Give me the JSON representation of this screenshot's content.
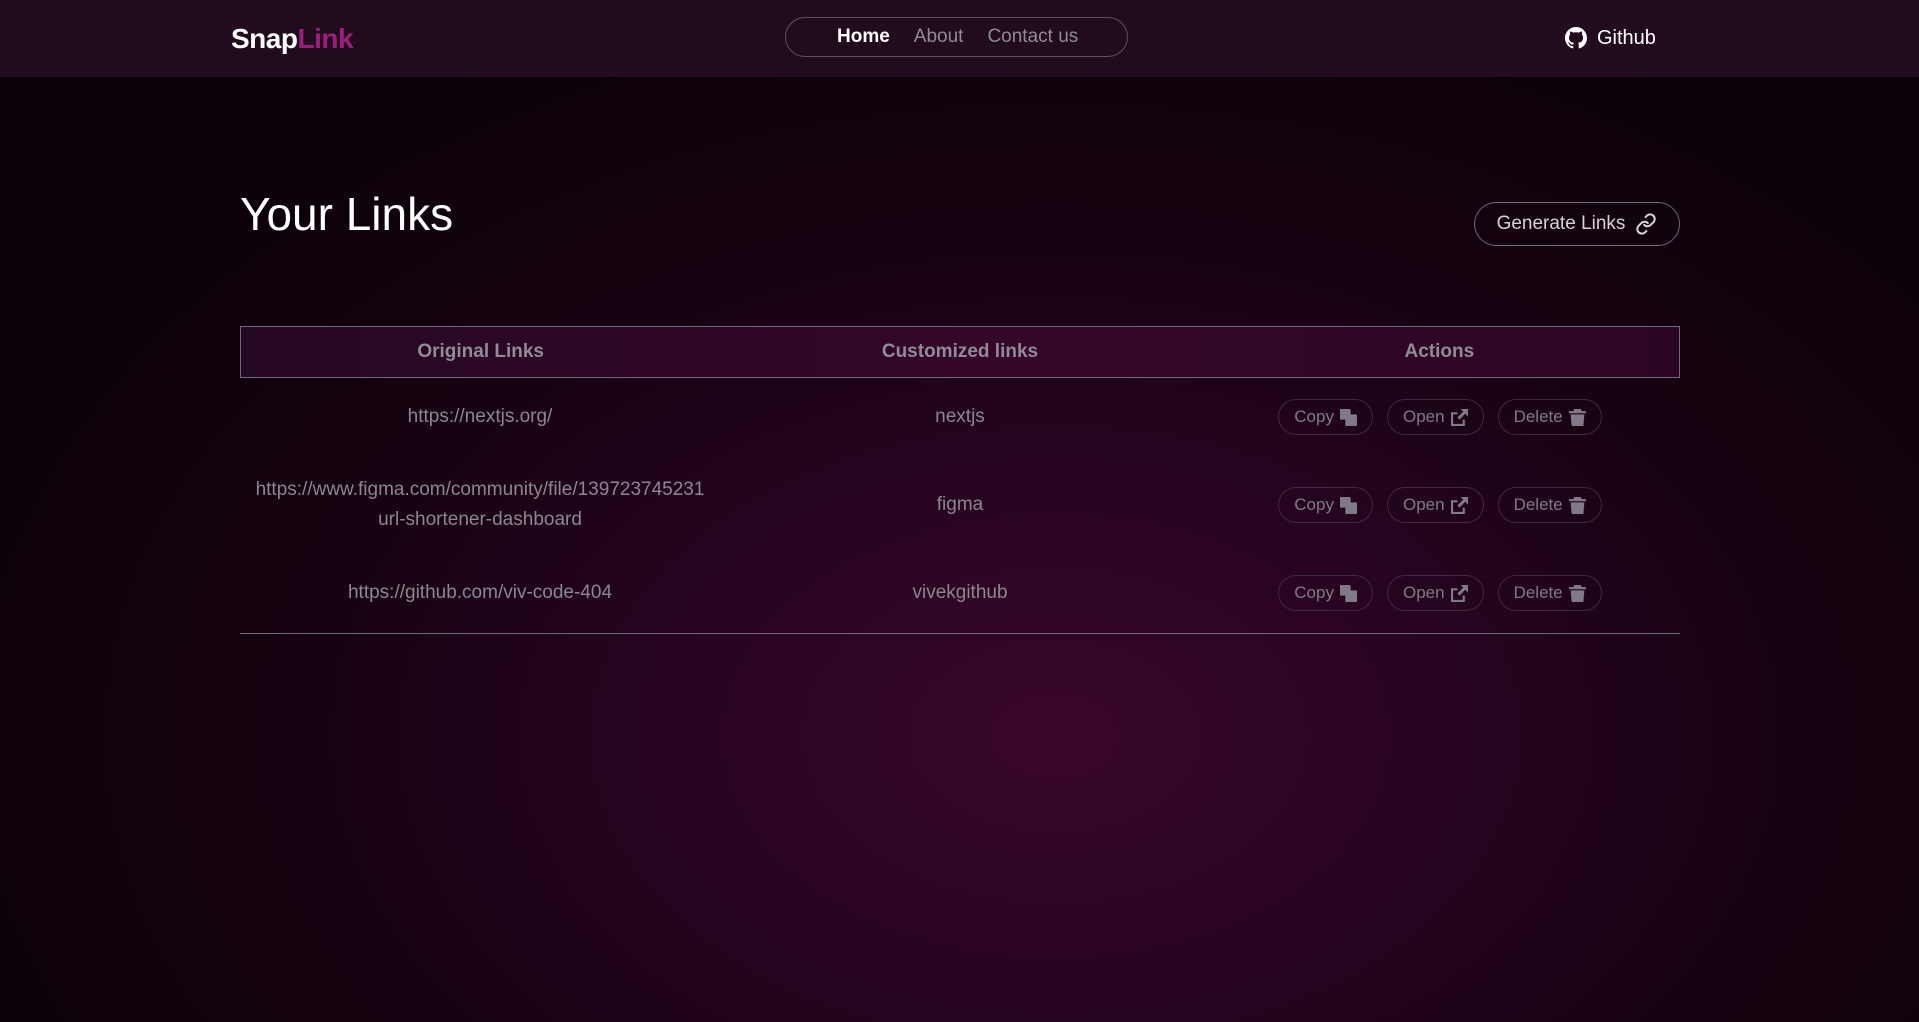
{
  "header": {
    "logo_part1": "Snap",
    "logo_part2": "Link",
    "logo_colors": {
      "snap": "#ffffff",
      "link": "#9a1f7c"
    },
    "nav": [
      {
        "label": "Home",
        "active": true
      },
      {
        "label": "About",
        "active": false
      },
      {
        "label": "Contact us",
        "active": false
      }
    ],
    "github_label": "Github",
    "github_icon": "github-icon"
  },
  "main": {
    "title": "Your Links",
    "generate_button": "Generate Links",
    "generate_icon": "link-icon"
  },
  "table": {
    "columns": [
      "Original Links",
      "Customized links",
      "Actions"
    ],
    "rows": [
      {
        "original": "https://nextjs.org/",
        "custom": "nextjs"
      },
      {
        "original_line1": "https://www.figma.com/community/file/139723745231",
        "original_line2": "url-shortener-dashboard",
        "custom": "figma"
      },
      {
        "original": "https://github.com/viv-code-404",
        "custom": "vivekgithub"
      }
    ],
    "action_labels": {
      "copy": "Copy",
      "open": "Open",
      "delete": "Delete"
    },
    "action_icons": {
      "copy": "copy-icon",
      "open": "external-link-icon",
      "delete": "trash-icon"
    }
  },
  "theme": {
    "background": "#15020f",
    "accent": "#9a1f7c",
    "topbar": "#230b1e"
  }
}
